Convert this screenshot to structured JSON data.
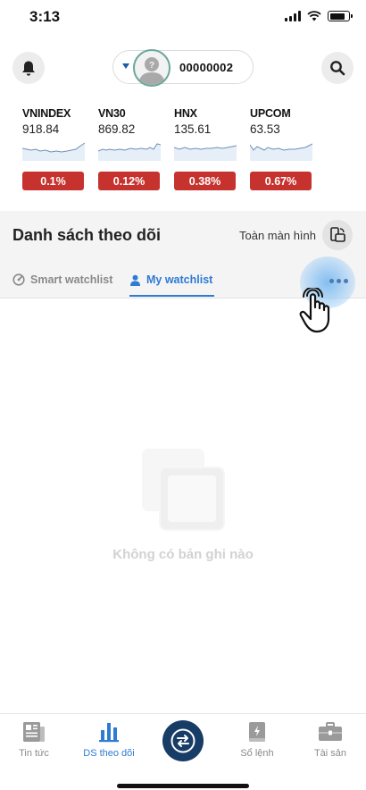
{
  "status_bar": {
    "time": "3:13"
  },
  "header": {
    "account_number": "00000002",
    "bell_icon": "bell-icon",
    "search_icon": "search-icon"
  },
  "indices": [
    {
      "name": "VNINDEX",
      "value": "918.84",
      "change": "0.1%"
    },
    {
      "name": "VN30",
      "value": "869.82",
      "change": "0.12%"
    },
    {
      "name": "HNX",
      "value": "135.61",
      "change": "0.38%"
    },
    {
      "name": "UPCOM",
      "value": "63.53",
      "change": "0.67%"
    }
  ],
  "watchlist": {
    "title": "Danh sách theo dõi",
    "fullscreen_label": "Toàn màn hình",
    "tabs": [
      {
        "label": "Smart watchlist",
        "icon": "gauge-icon",
        "active": false
      },
      {
        "label": "My watchlist",
        "icon": "user-icon",
        "active": true
      }
    ],
    "empty_message": "Không có bản ghi nào"
  },
  "bottom_nav": {
    "items": [
      {
        "label": "Tin tức",
        "icon": "news-icon",
        "active": false
      },
      {
        "label": "DS theo dõi",
        "icon": "bar-chart-icon",
        "active": true
      },
      {
        "label": "",
        "icon": "exchange-icon",
        "active": false
      },
      {
        "label": "Sổ lệnh",
        "icon": "order-book-icon",
        "active": false
      },
      {
        "label": "Tài sản",
        "icon": "briefcase-icon",
        "active": false
      }
    ]
  },
  "colors": {
    "accent": "#2f7bd3",
    "negative_badge": "#c6332f",
    "center_button": "#173c66"
  }
}
